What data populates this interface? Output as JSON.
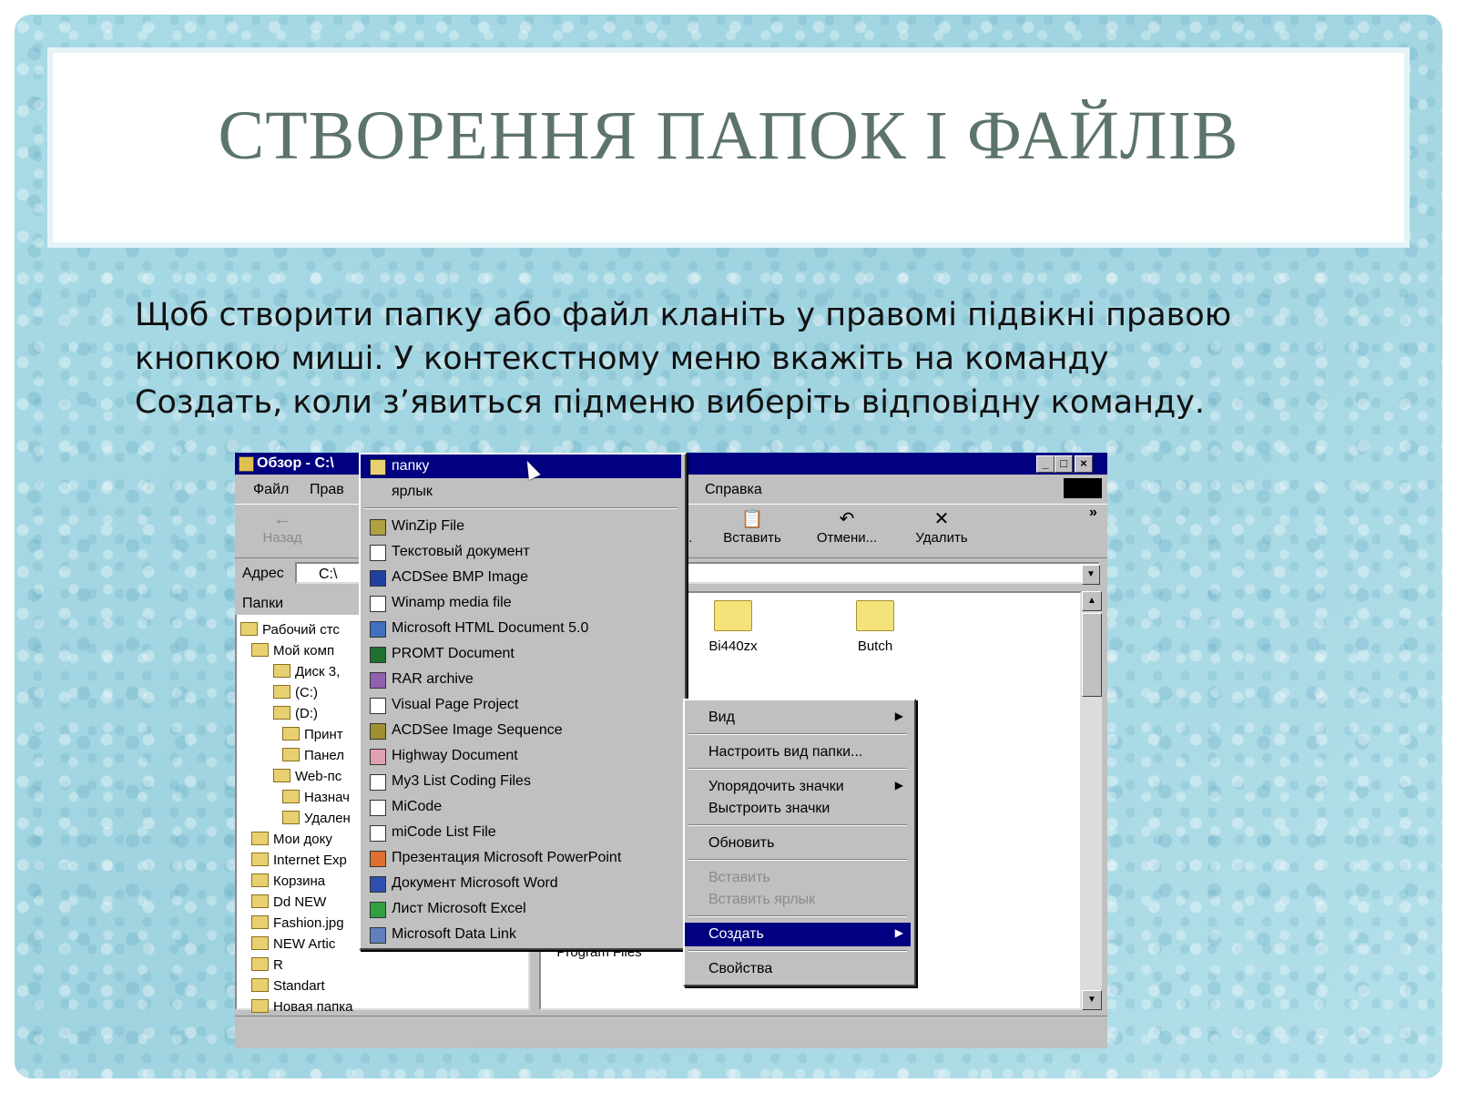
{
  "slide": {
    "title": "СТВОРЕННЯ ПАПОК І ФАЙЛІВ",
    "body_lines": [
      "Щоб створити папку або файл кланіть у правомі підвікні правою",
      "кнопкою миші. У контекстному меню вкажіть на команду",
      "Создать, коли з’явиться підменю виберіть відповідну команду."
    ]
  },
  "window": {
    "title": "Обзор - C:\\",
    "controls": {
      "minimize": "_",
      "maximize": "□",
      "close": "×"
    },
    "menu": {
      "file": "Файл",
      "edit": "Прав",
      "help": "Справка"
    },
    "toolbar": {
      "back": "Назад",
      "rename_partial": "ов...",
      "paste": "Вставить",
      "undo": "Отмени...",
      "delete": "Удалить",
      "more": "»"
    },
    "address": {
      "label": "Адрес",
      "value": "C:\\"
    },
    "folders_header": "Папки",
    "tree": [
      "Рабочий стс",
      "Мой комп",
      "Диск 3,",
      "(C:)",
      "(D:)",
      "Принт",
      "Панел",
      "Web-пс",
      "Назнач",
      "Удален",
      "Мои доку",
      "Internet Exp",
      "Корзина",
      "Dd NEW",
      "Fashion.jpg",
      "NEW Artic",
      "R",
      "Standart",
      "Новая папка"
    ],
    "files": [
      "Bi440zx",
      "Butch",
      "Program Files"
    ]
  },
  "new_submenu": [
    {
      "label": "папку",
      "icon": "folder-icon",
      "selected": true
    },
    {
      "label": "ярлык",
      "icon": "shortcut-icon"
    },
    {
      "label": "WinZip File",
      "icon": "winzip-icon"
    },
    {
      "label": "Текстовый документ",
      "icon": "text-document-icon"
    },
    {
      "label": "ACDSee BMP Image",
      "icon": "bmp-image-icon"
    },
    {
      "label": "Winamp media file",
      "icon": "media-file-icon"
    },
    {
      "label": "Microsoft HTML Document 5.0",
      "icon": "html-document-icon"
    },
    {
      "label": "PROMT Document",
      "icon": "promt-document-icon"
    },
    {
      "label": "RAR archive",
      "icon": "rar-archive-icon"
    },
    {
      "label": "Visual Page Project",
      "icon": "project-icon"
    },
    {
      "label": "ACDSee Image Sequence",
      "icon": "image-sequence-icon"
    },
    {
      "label": "Highway Document",
      "icon": "highway-document-icon"
    },
    {
      "label": "My3 List Coding Files",
      "icon": "coding-file-icon"
    },
    {
      "label": "MiCode",
      "icon": "micode-icon"
    },
    {
      "label": "miCode List File",
      "icon": "list-file-icon"
    },
    {
      "label": "Презентация Microsoft PowerPoint",
      "icon": "powerpoint-icon"
    },
    {
      "label": "Документ Microsoft Word",
      "icon": "word-icon"
    },
    {
      "label": "Лист Microsoft Excel",
      "icon": "excel-icon"
    },
    {
      "label": "Microsoft Data Link",
      "icon": "data-link-icon"
    }
  ],
  "context_menu": {
    "view": "Вид",
    "customize": "Настроить вид папки...",
    "arrange": "Упорядочить значки",
    "line_up": "Выстроить значки",
    "refresh": "Обновить",
    "paste": "Вставить",
    "paste_shortcut": "Вставить ярлык",
    "new": "Создать",
    "properties": "Свойства"
  },
  "colors": {
    "title_text": "#5d7469",
    "selection": "#000080",
    "slide_background": "#a9dbe6"
  }
}
